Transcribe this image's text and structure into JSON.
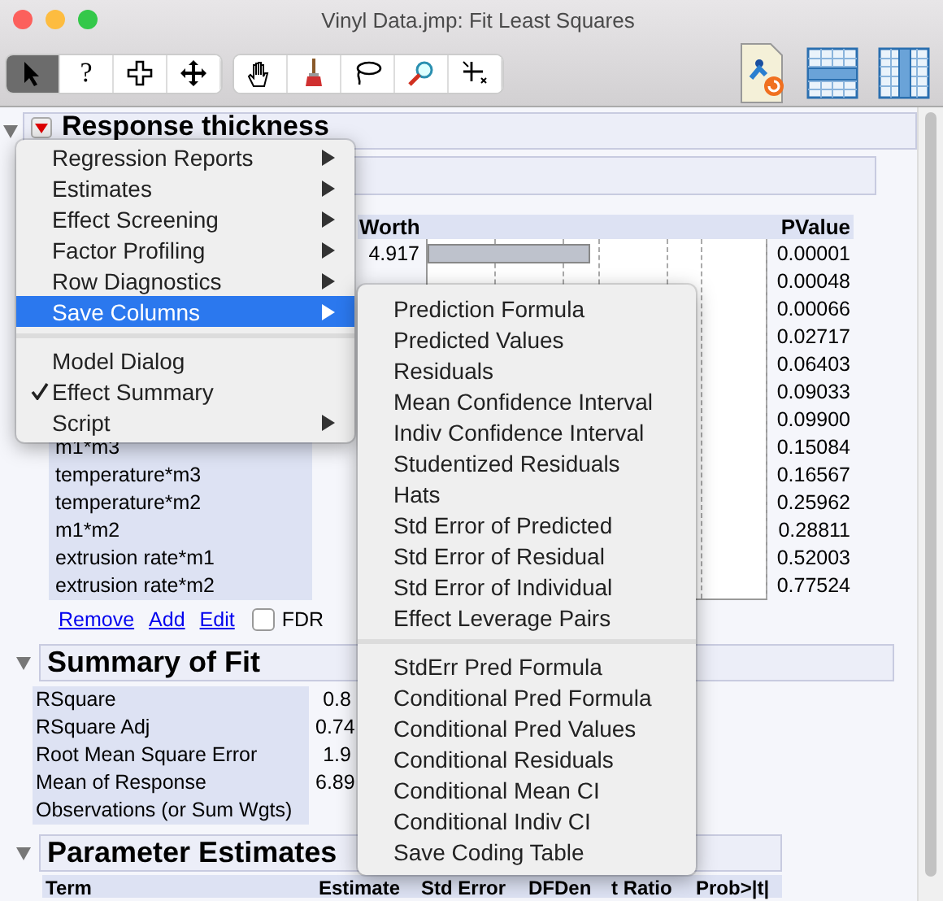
{
  "window": {
    "title": "Vinyl Data.jmp: Fit Least Squares"
  },
  "toolbar": {
    "tools": [
      {
        "kind": "arrow",
        "selected": true
      },
      {
        "kind": "help",
        "text": "?",
        "selected": false
      },
      {
        "kind": "crosshair",
        "selected": false
      },
      {
        "kind": "move",
        "selected": false
      },
      {
        "kind": "hand",
        "selected": false
      },
      {
        "kind": "brush",
        "selected": false
      },
      {
        "kind": "lasso",
        "selected": false
      },
      {
        "kind": "magnifier",
        "selected": false
      },
      {
        "kind": "scaler",
        "selected": false
      }
    ],
    "right": [
      {
        "kind": "document"
      },
      {
        "kind": "rows"
      },
      {
        "kind": "columns"
      }
    ]
  },
  "response": {
    "title": "Response thickness",
    "expanded": true
  },
  "effect_summary": {
    "worth_header": "Worth",
    "pvalue_header": "PValue",
    "rows": [
      {
        "worth": "4.917",
        "pvalue": "0.00001"
      },
      {
        "pvalue": "0.00048"
      },
      {
        "pvalue": "0.00066"
      },
      {
        "pvalue": "0.02717"
      },
      {
        "pvalue": "0.06403"
      },
      {
        "pvalue": "0.09033"
      },
      {
        "pvalue": "0.09900"
      },
      {
        "term": "m1*m3",
        "pvalue": "0.15084"
      },
      {
        "term": "temperature*m3",
        "pvalue": "0.16567"
      },
      {
        "term": "temperature*m2",
        "pvalue": "0.25962"
      },
      {
        "term": "m1*m2",
        "pvalue": "0.28811"
      },
      {
        "term": "extrusion rate*m1",
        "pvalue": "0.52003"
      },
      {
        "term": "extrusion rate*m2",
        "pvalue": "0.77524"
      }
    ],
    "links": [
      "Remove",
      "Add",
      "Edit"
    ],
    "fdr": {
      "label": "FDR",
      "checked": false
    }
  },
  "summary_of_fit": {
    "title": "Summary of Fit",
    "expanded": true,
    "rows": [
      {
        "label": "RSquare",
        "value": "0.8"
      },
      {
        "label": "RSquare Adj",
        "value": "0.74"
      },
      {
        "label": "Root Mean Square Error",
        "value": "1.9"
      },
      {
        "label": "Mean of Response",
        "value": "6.89"
      },
      {
        "label": "Observations (or Sum Wgts)"
      }
    ]
  },
  "parameter_estimates": {
    "title": "Parameter Estimates",
    "expanded": true,
    "columns": [
      "Term",
      "Estimate",
      "Std Error",
      "DFDen",
      "t Ratio",
      "Prob>|t|"
    ]
  },
  "menu": {
    "items": [
      {
        "label": "Regression Reports",
        "submenu": true,
        "selected": false,
        "checked": false
      },
      {
        "label": "Estimates",
        "submenu": true,
        "selected": false,
        "checked": false
      },
      {
        "label": "Effect Screening",
        "submenu": true,
        "selected": false,
        "checked": false
      },
      {
        "label": "Factor Profiling",
        "submenu": true,
        "selected": false,
        "checked": false
      },
      {
        "label": "Row Diagnostics",
        "submenu": true,
        "selected": false,
        "checked": false
      },
      {
        "label": "Save Columns",
        "submenu": true,
        "selected": true,
        "checked": false
      },
      {
        "kind": "separator"
      },
      {
        "label": "Model Dialog",
        "submenu": false,
        "selected": false,
        "checked": false
      },
      {
        "label": "Effect Summary",
        "submenu": false,
        "selected": false,
        "checked": true
      },
      {
        "label": "Script",
        "submenu": true,
        "selected": false,
        "checked": false
      }
    ]
  },
  "submenu": {
    "items": [
      {
        "label": "Prediction Formula"
      },
      {
        "label": "Predicted Values"
      },
      {
        "label": "Residuals"
      },
      {
        "label": "Mean Confidence Interval"
      },
      {
        "label": "Indiv Confidence Interval"
      },
      {
        "label": "Studentized Residuals"
      },
      {
        "label": "Hats"
      },
      {
        "label": "Std Error of Predicted"
      },
      {
        "label": "Std Error of Residual"
      },
      {
        "label": "Std Error of Individual"
      },
      {
        "label": "Effect Leverage Pairs"
      },
      {
        "kind": "separator"
      },
      {
        "label": "StdErr Pred Formula"
      },
      {
        "label": "Conditional Pred Formula"
      },
      {
        "label": "Conditional Pred Values"
      },
      {
        "label": "Conditional Residuals"
      },
      {
        "label": "Conditional Mean CI"
      },
      {
        "label": "Conditional Indiv CI"
      },
      {
        "label": "Save Coding Table"
      }
    ]
  }
}
